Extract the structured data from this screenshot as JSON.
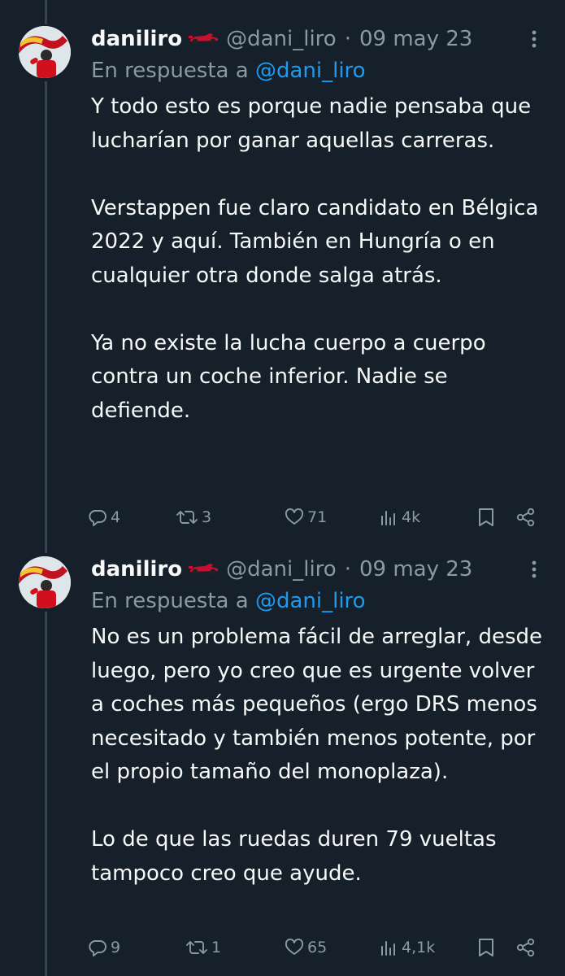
{
  "tweets": [
    {
      "name": "daniliro",
      "handle": "@dani_liro",
      "separator": "·",
      "date": "09 may 23",
      "reply_prefix": "En respuesta a",
      "reply_mention": "@dani_liro",
      "paragraphs": [
        "Y todo esto es porque nadie pensaba que lucharían por ganar aquellas carreras.",
        "Verstappen fue claro candidato en Bélgica 2022 y aquí. También en Hungría o en cualquier otra donde salga atrás.",
        "Ya no existe la lucha cuerpo a cuerpo contra un coche inferior. Nadie se defiende."
      ],
      "replies": "4",
      "retweets": "3",
      "likes": "71",
      "views": "4k"
    },
    {
      "name": "daniliro",
      "handle": "@dani_liro",
      "separator": "·",
      "date": "09 may 23",
      "reply_prefix": "En respuesta a",
      "reply_mention": "@dani_liro",
      "paragraphs": [
        "No es un problema fácil de arreglar, desde luego, pero yo creo que es urgente volver a coches más pequeños (ergo DRS menos necesitado y también menos potente, por el propio tamaño del monoplaza).",
        "Lo de que las ruedas duren 79 vueltas tampoco creo que ayude."
      ],
      "replies": "9",
      "retweets": "1",
      "likes": "65",
      "views": "4,1k"
    }
  ],
  "icons": {
    "name_emoji": "race-car-icon",
    "more": "more-options-icon",
    "reply": "reply-icon",
    "retweet": "retweet-icon",
    "like": "heart-icon",
    "views": "views-icon",
    "bookmark": "bookmark-icon",
    "share": "share-icon"
  },
  "colors": {
    "background": "#15202b",
    "text": "#f7f9f9",
    "muted": "#8b98a5",
    "link": "#1d9bf0",
    "thread_line": "#38444d"
  }
}
